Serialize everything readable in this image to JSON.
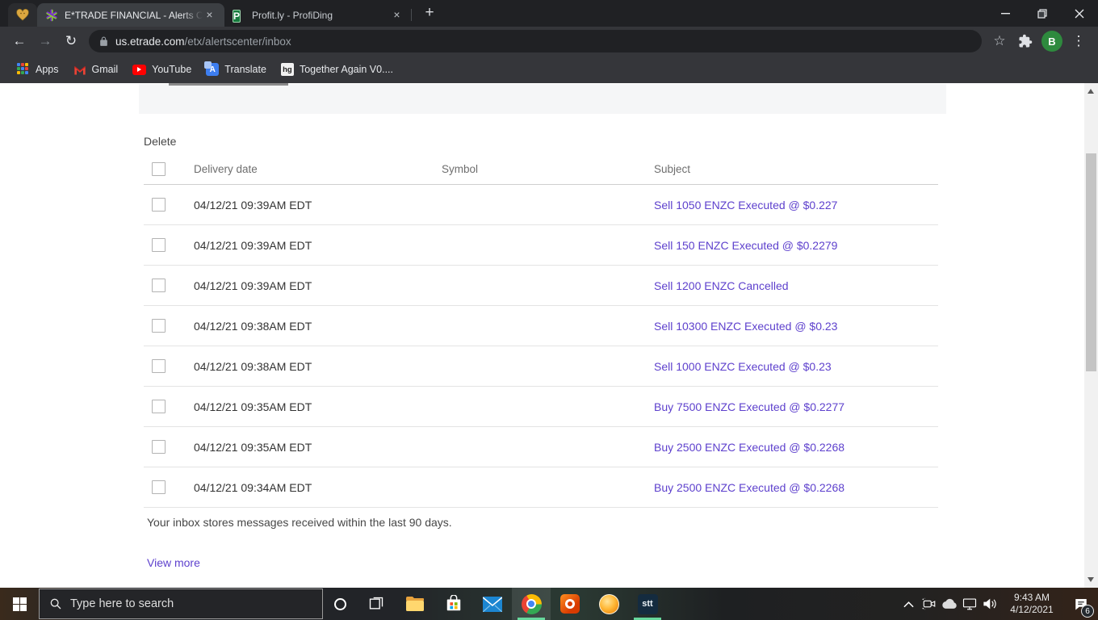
{
  "browser": {
    "tabs": [
      {
        "title": "E*TRADE FINANCIAL - Alerts Cen",
        "favicon": "etrade-star-icon",
        "active": true
      },
      {
        "title": "Profit.ly - ProfiDing",
        "favicon": "profitly-p-icon",
        "active": false
      }
    ],
    "pinned_tab": {
      "favicon": "gold-heart-icon"
    },
    "url": {
      "domain": "us.etrade.com",
      "path": "/etx/alertscenter/inbox"
    },
    "profile_initial": "B",
    "icons": {
      "profitly_letter": "P",
      "hg_label": "hg"
    },
    "glyphs": {
      "back": "←",
      "forward": "→",
      "reload": "↻",
      "star": "☆",
      "kebab": "⋮",
      "new_tab": "+",
      "tab_close": "×"
    },
    "bookmarks": [
      {
        "label": "Apps"
      },
      {
        "label": "Gmail"
      },
      {
        "label": "YouTube"
      },
      {
        "label": "Translate"
      },
      {
        "label": "Together Again V0...."
      }
    ]
  },
  "page": {
    "toolbar": {
      "delete_label": "Delete"
    },
    "table": {
      "headers": [
        "Delivery date",
        "Symbol",
        "Subject"
      ],
      "rows": [
        {
          "date": "04/12/21 09:39AM EDT",
          "symbol": "",
          "subject": "Sell 1050 ENZC Executed @ $0.227"
        },
        {
          "date": "04/12/21 09:39AM EDT",
          "symbol": "",
          "subject": "Sell 150 ENZC Executed @ $0.2279"
        },
        {
          "date": "04/12/21 09:39AM EDT",
          "symbol": "",
          "subject": "Sell 1200 ENZC Cancelled"
        },
        {
          "date": "04/12/21 09:38AM EDT",
          "symbol": "",
          "subject": "Sell 10300 ENZC Executed @ $0.23"
        },
        {
          "date": "04/12/21 09:38AM EDT",
          "symbol": "",
          "subject": "Sell 1000 ENZC Executed @ $0.23"
        },
        {
          "date": "04/12/21 09:35AM EDT",
          "symbol": "",
          "subject": "Buy 7500 ENZC Executed @ $0.2277"
        },
        {
          "date": "04/12/21 09:35AM EDT",
          "symbol": "",
          "subject": "Buy 2500 ENZC Executed @ $0.2268"
        },
        {
          "date": "04/12/21 09:34AM EDT",
          "symbol": "",
          "subject": "Buy 2500 ENZC Executed @ $0.2268"
        }
      ],
      "footnote": "Your inbox stores messages received within the last 90 days.",
      "view_more_label": "View more"
    },
    "colors": {
      "link_purple": "#5e41cd",
      "band_gray": "#f5f6f7"
    }
  },
  "taskbar": {
    "search_placeholder": "Type here to search",
    "stt_label": "stt",
    "clock": {
      "time": "9:43 AM",
      "date": "4/12/2021"
    },
    "notification_count": "6",
    "colors": {
      "running_accent": "#67d79c"
    }
  }
}
